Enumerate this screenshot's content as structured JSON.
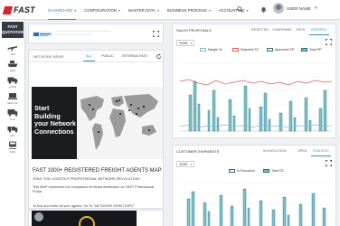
{
  "header": {
    "logo_text": "FAST",
    "menu": [
      {
        "label": "DASHBOARD",
        "active": true
      },
      {
        "label": "CONFIGURATION",
        "active": false
      },
      {
        "label": "MASTER DATA",
        "active": false
      },
      {
        "label": "BUSINESS PROCESS",
        "active": false
      },
      {
        "label": "ACCOUNTING",
        "active": false
      }
    ],
    "user_name": "USER NAME"
  },
  "sidebar": {
    "title_line1": "FAST",
    "title_line2": "QUOTATION",
    "items": [
      {
        "icon": "plane-icon",
        "label": "AIR"
      },
      {
        "icon": "ship-icon",
        "label": "SEA"
      },
      {
        "icon": "truck-icon",
        "label": "LAND"
      },
      {
        "icon": "pallet-icon",
        "label": "SEA LCL"
      },
      {
        "icon": "ftl-truck-icon",
        "label": "FTL"
      },
      {
        "icon": "ltl-truck-icon",
        "label": "LTL"
      },
      {
        "icon": "rail-icon",
        "label": "RAIL"
      }
    ]
  },
  "news": {
    "title": "NETWORK NEWS",
    "tabs": [
      "ALL",
      "PUBLIC",
      "INTERNAL",
      "FAST"
    ],
    "active_tab": "ALL",
    "banner_text": "Start Building your Network Connections",
    "headline": "FAST 1000+ REGISTERED FREIGHT AGENTS MAP",
    "subline": "JOINT THE LOGISTICS PROFESSIONAL NETWORK REVOLUTION!",
    "body": "This MAP represents the companies territorial distribution on FAST Professional Portal.",
    "body2": "To find and invite all your agents, Go To \"NETWORK DIRECTORY\""
  },
  "sales": {
    "title": "SALES PROPOSALS",
    "tabs": [
      "REJECTED",
      "CONFIRMED",
      "OPEN",
      "STATISTIC"
    ],
    "active_tab": "STATISTIC",
    "dropdown": "YEAR",
    "legend": [
      {
        "label": "Margin %",
        "color": "#7ac0c8"
      },
      {
        "label": "Rejected SP",
        "color": "#e05a5a"
      },
      {
        "label": "Approved SP",
        "color": "#2c6e80"
      },
      {
        "label": "Total SP",
        "color": "#2c6e80"
      }
    ]
  },
  "shipments": {
    "title": "CUSTOMER SHIPMENTS",
    "tabs": [
      "IN EXECUTION",
      "OPEN",
      "STATISTIC"
    ],
    "active_tab": "STATISTIC",
    "dropdown": "YEAR",
    "legend": [
      {
        "label": "In Execution",
        "color": "#2c6e80"
      },
      {
        "label": "Total CS",
        "color": "#7ac0c8"
      }
    ]
  },
  "colors": {
    "accent": "#2a8fbd",
    "brand": "#d8262c",
    "teal_dark": "#2c6e80",
    "teal_light": "#7ac0c8",
    "red": "#e05a5a"
  }
}
